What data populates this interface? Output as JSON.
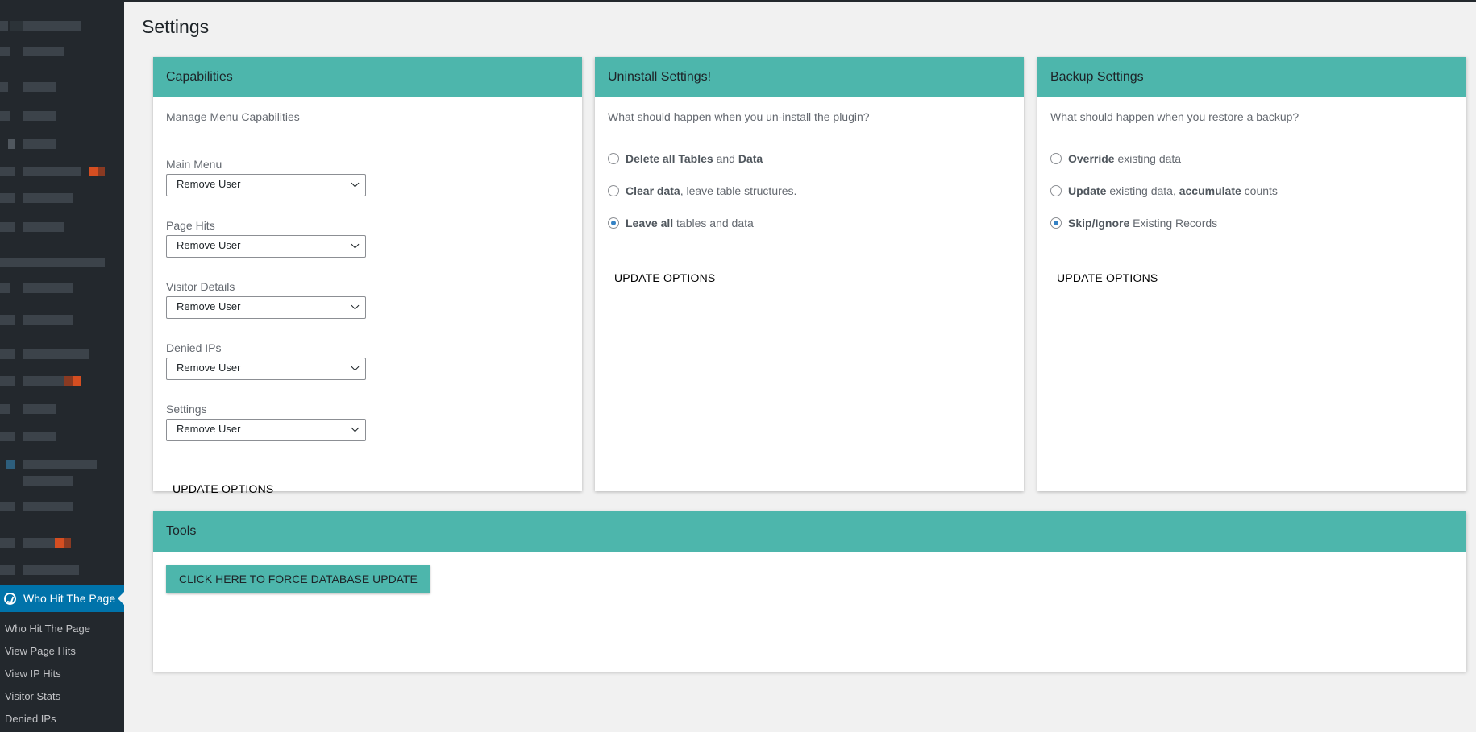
{
  "page": {
    "title": "Settings"
  },
  "sidebar": {
    "active_item": "Who Hit The Page",
    "submenu": [
      "Who Hit The Page",
      "View Page Hits",
      "View IP Hits",
      "Visitor Stats",
      "Denied IPs"
    ]
  },
  "capabilities": {
    "title": "Capabilities",
    "intro": "Manage Menu Capabilities",
    "fields": [
      {
        "label": "Main Menu",
        "value": "Remove User"
      },
      {
        "label": "Page Hits",
        "value": "Remove User"
      },
      {
        "label": "Visitor Details",
        "value": "Remove User"
      },
      {
        "label": "Denied IPs",
        "value": "Remove User"
      },
      {
        "label": "Settings",
        "value": "Remove User"
      }
    ],
    "update_label": "UPDATE OPTIONS"
  },
  "uninstall": {
    "title": "Uninstall Settings!",
    "intro": "What should happen when you un-install the plugin?",
    "options": [
      {
        "bold1": "Delete all Tables",
        "text1": " and ",
        "bold2": "Data",
        "text2": "",
        "checked": false
      },
      {
        "bold1": "Clear data",
        "text1": ", leave table structures.",
        "bold2": "",
        "text2": "",
        "checked": false
      },
      {
        "bold1": "Leave all",
        "text1": " tables and data",
        "bold2": "",
        "text2": "",
        "checked": true
      }
    ],
    "update_label": "UPDATE OPTIONS"
  },
  "backup": {
    "title": "Backup Settings",
    "intro": "What should happen when you restore a backup?",
    "options": [
      {
        "bold1": "Override",
        "text1": " existing data",
        "bold2": "",
        "text2": "",
        "checked": false
      },
      {
        "bold1": "Update",
        "text1": " existing data, ",
        "bold2": "accumulate",
        "text2": " counts",
        "checked": false
      },
      {
        "bold1": "Skip/Ignore",
        "text1": " Existing Records",
        "bold2": "",
        "text2": "",
        "checked": true
      }
    ],
    "update_label": "UPDATE OPTIONS"
  },
  "tools": {
    "title": "Tools",
    "button_label": "CLICK HERE TO FORCE DATABASE UPDATE"
  },
  "colors": {
    "header_teal": "#4db6ac",
    "sidebar_bg": "#23282d",
    "active_blue": "#0073aa",
    "radio_checked": "#3582c4"
  }
}
